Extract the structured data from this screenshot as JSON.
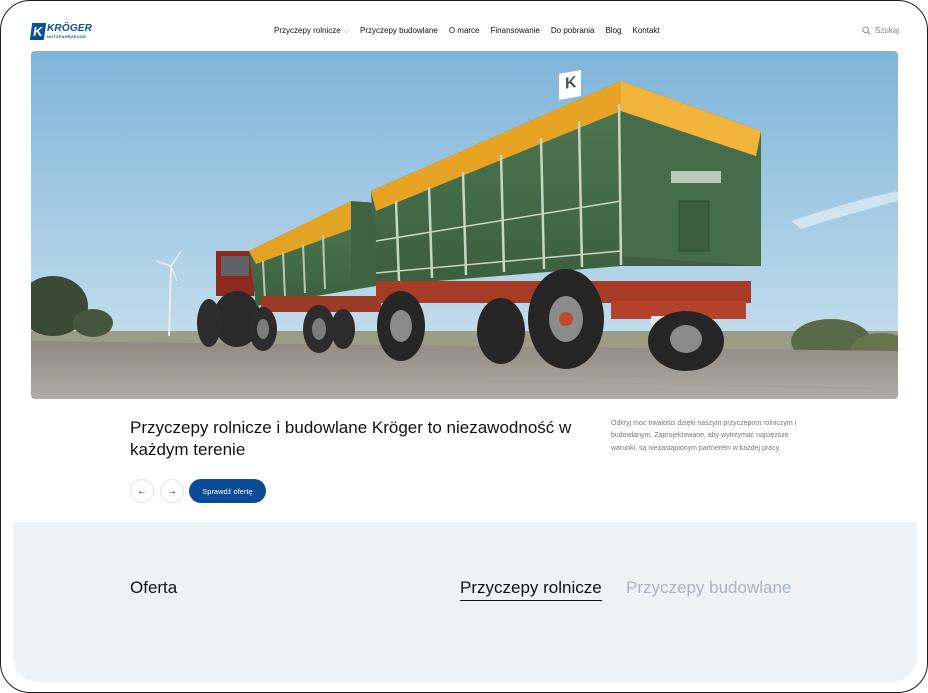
{
  "brand": {
    "logo_letter": "K",
    "name": "KRÖGER",
    "tagline": "NUTZFAHRZEUGE"
  },
  "nav": {
    "items": [
      {
        "label": "Przyczepy rolnicze",
        "has_dropdown": true
      },
      {
        "label": "Przyczepy budowlane"
      },
      {
        "label": "O marce"
      },
      {
        "label": "Finansowanie"
      },
      {
        "label": "Do pobrania"
      },
      {
        "label": "Blog"
      },
      {
        "label": "Kontakt"
      }
    ]
  },
  "search": {
    "label": "Szukaj",
    "icon": "search-icon"
  },
  "hero": {
    "trailer_plate": "K",
    "headline": "Przyczepy rolnicze i budowlane Kröger to niezawodność w każdym terenie",
    "description": "Odkryj moc trwałości dzięki naszym przyczepom rolniczym i budowlanym. Zaprojektowane, aby wytrzymać najcięższe warunki, są niezastąpionym partnerem w każdej pracy.",
    "prev_icon": "←",
    "next_icon": "→",
    "cta_label": "Sprawdź ofertę"
  },
  "offer": {
    "title": "Oferta",
    "tabs": [
      {
        "label": "Przyczepy rolnicze",
        "active": true
      },
      {
        "label": "Przyczepy budowlane",
        "active": false
      }
    ]
  },
  "colors": {
    "brand_blue": "#0b4a96",
    "section_bg": "#eef2f5",
    "tab_inactive": "#a6b5c3"
  }
}
